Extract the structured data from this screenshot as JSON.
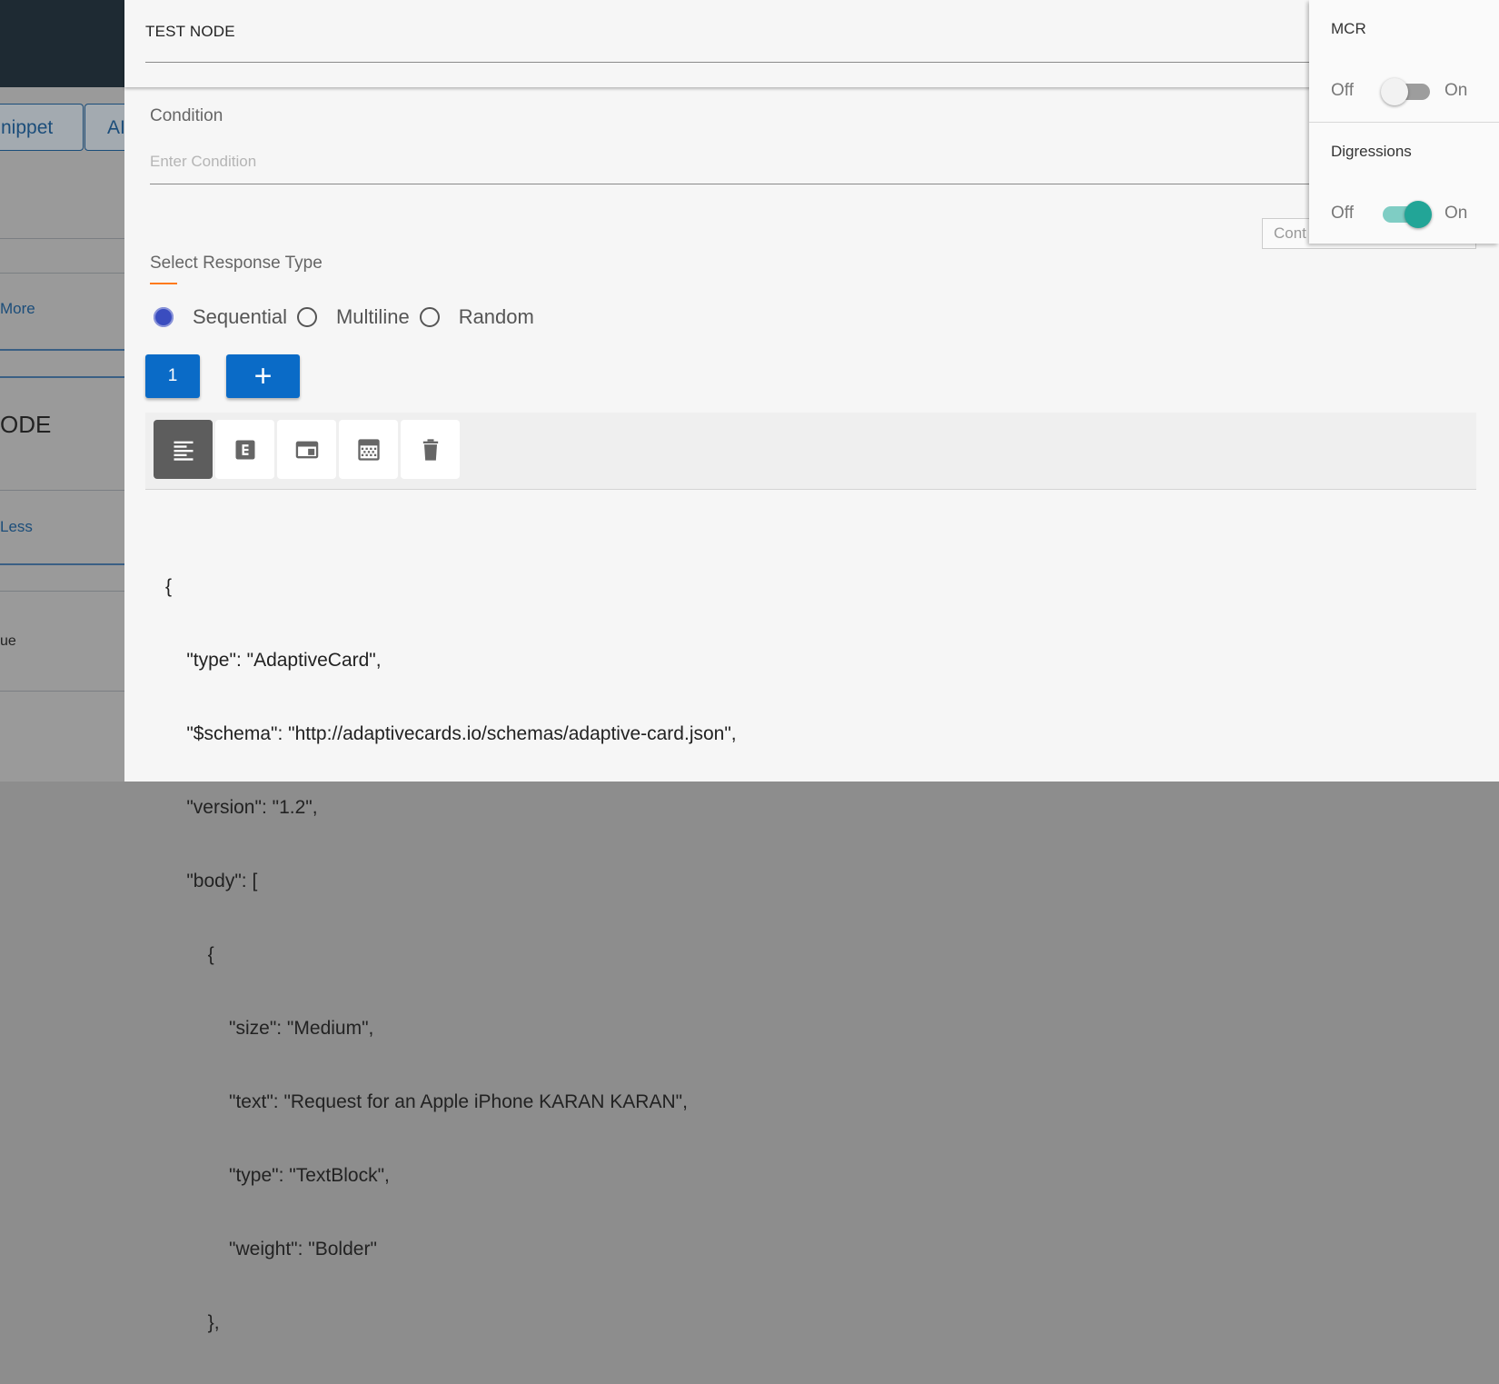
{
  "background": {
    "buttons": [
      "nippet",
      "AI"
    ],
    "more_link": "More",
    "node_title": "ODE",
    "less_link": "Less",
    "value_text": "ue"
  },
  "panel": {
    "title": "TEST NODE",
    "condition": {
      "label": "Condition",
      "placeholder": "Enter Condition",
      "value": ""
    },
    "context_button": "Cont",
    "response_type": {
      "label": "Select Response Type",
      "options": [
        {
          "label": "Sequential",
          "selected": true
        },
        {
          "label": "Multiline",
          "selected": false
        },
        {
          "label": "Random",
          "selected": false
        }
      ]
    },
    "pagination": {
      "current": "1",
      "add_label": "+"
    },
    "toolbar": {
      "tools": [
        {
          "icon": "text-align-icon",
          "active": true
        },
        {
          "icon": "adaptive-card-icon",
          "active": false
        },
        {
          "icon": "card-layout-icon",
          "active": false
        },
        {
          "icon": "grid-table-icon",
          "active": false
        },
        {
          "icon": "trash-icon",
          "active": false
        }
      ]
    },
    "code_lines": [
      "{",
      "    \"type\": \"AdaptiveCard\",",
      "    \"$schema\": \"http://adaptivecards.io/schemas/adaptive-card.json\",",
      "    \"version\": \"1.2\",",
      "    \"body\": [",
      "        {",
      "            \"size\": \"Medium\",",
      "            \"text\": \"Request for an Apple iPhone KARAN KARAN\",",
      "            \"type\": \"TextBlock\",",
      "            \"weight\": \"Bolder\"",
      "        },"
    ]
  },
  "settings": {
    "sections": [
      {
        "title": "MCR",
        "off_label": "Off",
        "on_label": "On",
        "enabled": false
      },
      {
        "title": "Digressions",
        "off_label": "Off",
        "on_label": "On",
        "enabled": true
      }
    ]
  },
  "colors": {
    "primary_button": "#0a6bc7",
    "radio_selected": "#3a4dbf",
    "toggle_on": "#22a597",
    "accent_underline": "#ff7a1a"
  }
}
